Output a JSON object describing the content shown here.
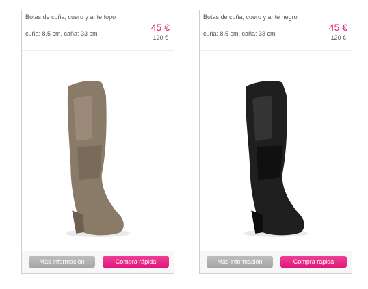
{
  "products": [
    {
      "title": "Botas de cuña, cuero y ante topo",
      "spec": "cuña: 8,5 cm, caña: 33 cm",
      "price": "45 €",
      "old_price": "120 €",
      "colors": {
        "boot": "#8a7a68",
        "boot_dark": "#6e6050",
        "boot_light": "#a29280"
      },
      "info_label": "Más información",
      "buy_label": "Compra rápida"
    },
    {
      "title": "Botas de cuña, cuero y ante negro",
      "spec": "cuña: 8,5 cm, caña: 33 cm",
      "price": "45 €",
      "old_price": "120 €",
      "colors": {
        "boot": "#1f1f1f",
        "boot_dark": "#0d0d0d",
        "boot_light": "#3a3a3a"
      },
      "info_label": "Más información",
      "buy_label": "Compra rápida"
    }
  ],
  "accent_color": "#e5197b"
}
